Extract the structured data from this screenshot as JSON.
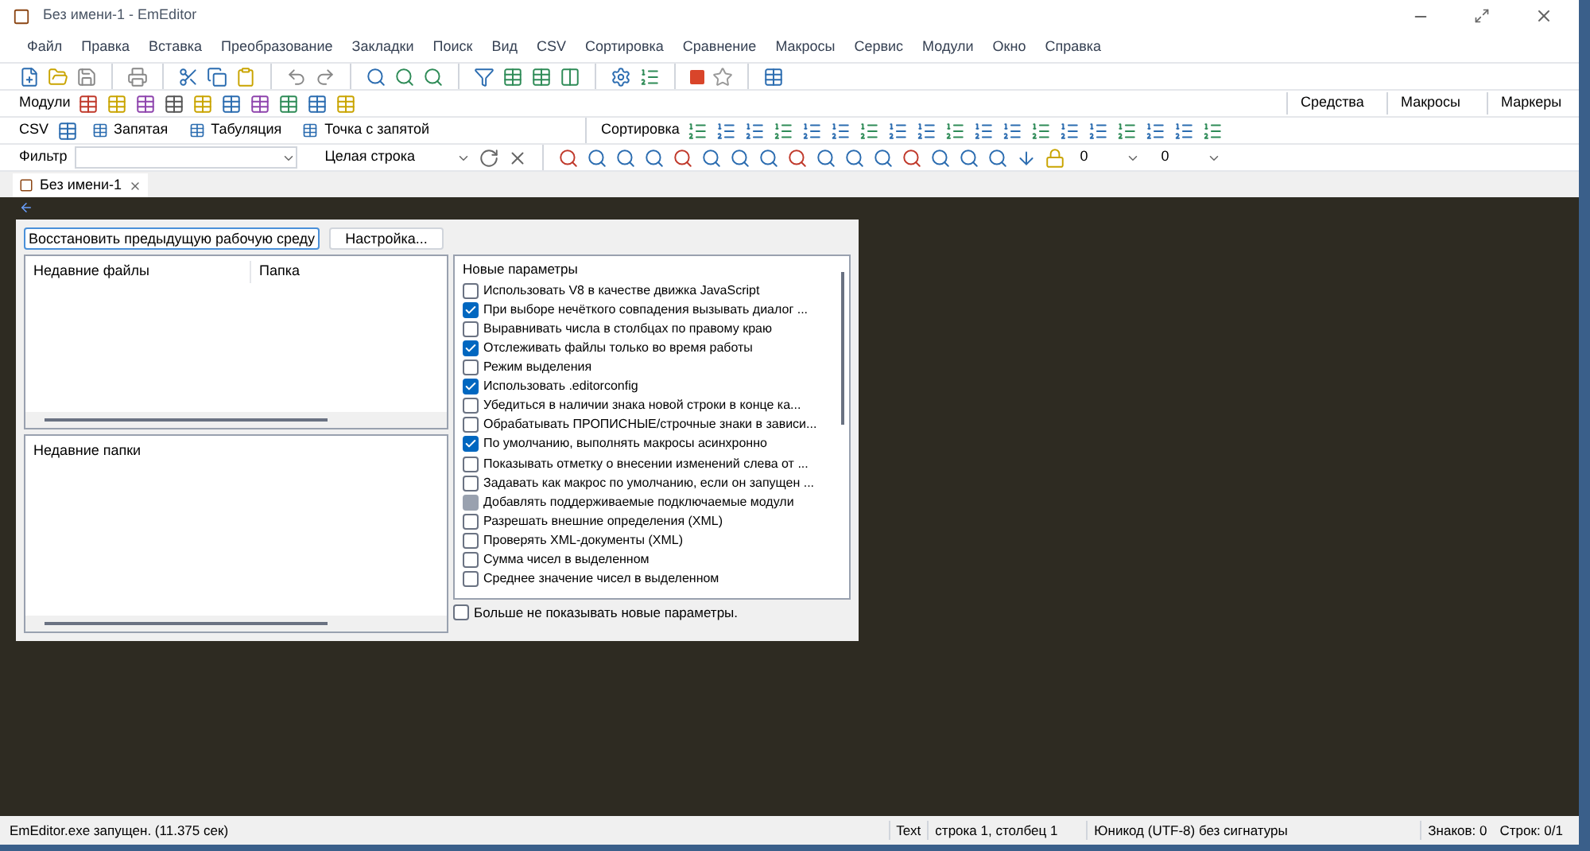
{
  "window": {
    "title": "Без имени-1 - EmEditor"
  },
  "menu": [
    "Файл",
    "Правка",
    "Вставка",
    "Преобразование",
    "Закладки",
    "Поиск",
    "Вид",
    "CSV",
    "Сортировка",
    "Сравнение",
    "Макросы",
    "Сервис",
    "Модули",
    "Окно",
    "Справка"
  ],
  "plugins_toolbar": {
    "label": "Модули"
  },
  "side_toolbars": [
    "Средства",
    "Макросы",
    "Маркеры"
  ],
  "csv_toolbar": {
    "label": "CSV",
    "items": [
      "Запятая",
      "Табуляция",
      "Точка с запятой"
    ]
  },
  "sort_toolbar": {
    "label": "Сортировка"
  },
  "filter_toolbar": {
    "label": "Фильтр",
    "mode": "Целая строка",
    "field_1": "0",
    "field_2": "0"
  },
  "tabs": [
    {
      "label": "Без имени-1",
      "selected": true
    }
  ],
  "start_panel": {
    "restore_button": "Восстановить предыдущую рабочую среду",
    "settings_button": "Настройка...",
    "recent_files": {
      "columns": [
        "Недавние файлы",
        "Папка"
      ]
    },
    "recent_folders": {
      "columns": [
        "Недавние папки"
      ]
    },
    "new_options": {
      "title": "Новые параметры",
      "items": [
        {
          "kind": "checkbox",
          "label": "Использовать V8 в качестве движка JavaScript",
          "checked": false
        },
        {
          "kind": "checkbox",
          "label": "При выборе нечёткого совпадения вызывать диалог ...",
          "checked": true
        },
        {
          "kind": "checkbox",
          "label": "Выравнивать числа в столбцах по правому краю",
          "checked": false
        },
        {
          "kind": "checkbox",
          "label": "Отслеживать файлы только во время работы",
          "checked": true
        },
        {
          "kind": "checkbox",
          "label": "Режим выделения",
          "checked": false
        },
        {
          "kind": "checkbox",
          "label": "Использовать .editorconfig",
          "checked": true
        },
        {
          "kind": "checkbox",
          "label": "Убедиться в наличии знака новой строки в конце ка...",
          "checked": false
        },
        {
          "kind": "checkbox",
          "label": "Обрабатывать ПРОПИСНЫЕ/строчные знаки в зависи...",
          "checked": false
        },
        {
          "kind": "checkbox",
          "label": "По умолчанию, выполнять макросы асинхронно",
          "checked": true
        },
        {
          "kind": "checkbox",
          "label": "Показывать отметку о внесении изменений слева от ...",
          "checked": false
        },
        {
          "kind": "checkbox",
          "label": "Задавать как макрос по умолчанию, если он запущен ...",
          "checked": false
        },
        {
          "kind": "partial",
          "label": "Добавлять поддерживаемые подключаемые модули",
          "checked": false
        },
        {
          "kind": "checkbox",
          "label": "Разрешать внешние определения (XML)",
          "checked": false
        },
        {
          "kind": "checkbox",
          "label": "Проверять XML-документы (XML)",
          "checked": false
        },
        {
          "kind": "checkbox",
          "label": "Сумма чисел в выделенном",
          "checked": false
        },
        {
          "kind": "checkbox",
          "label": "Среднее значение чисел в выделенном",
          "checked": false
        }
      ]
    },
    "dont_show": {
      "label": "Больше не показывать новые параметры.",
      "checked": false
    }
  },
  "status_bar": {
    "message": "EmEditor.exe запущен. (11.375 сек)",
    "mode": "Text",
    "position": "строка 1, столбец 1",
    "encoding": "Юникод (UTF-8) без сигнатуры",
    "chars": "Знаков: 0",
    "lines": "Строк: 0/1"
  }
}
